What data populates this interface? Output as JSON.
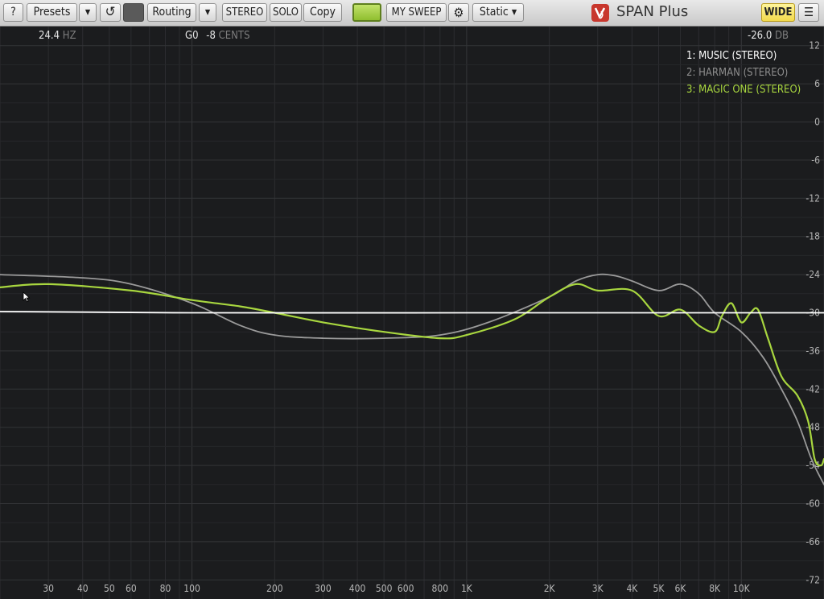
{
  "toolbar": {
    "help": "?",
    "presets": "Presets",
    "presets_arrow": "▾",
    "reset_icon": "↺",
    "routing": "Routing",
    "routing_arrow": "▾",
    "stereo": "STEREO",
    "solo": "SOLO",
    "copy": "Copy",
    "my_sweep": "MY SWEEP",
    "gear_icon": "⚙",
    "static": "Static ▾",
    "app_name": "SPAN Plus",
    "wide": "WIDE",
    "menu_icon": "☰"
  },
  "readouts": {
    "freq_value": "24.4",
    "freq_unit": "HZ",
    "note_name": "G0",
    "cents_value": "-8",
    "cents_unit": "CENTS",
    "db_value": "-26.0",
    "db_unit": "DB"
  },
  "colors": {
    "background": "#1b1c1e",
    "grid": "#2c2d30",
    "music": "#ffffff",
    "harman": "#9a9a9a",
    "magic_one": "#a8d63f",
    "led": "#9ccb35",
    "wide": "#f5e064"
  },
  "chart_data": {
    "type": "line",
    "xscale": "log",
    "xlim": [
      20,
      20000
    ],
    "ylim": [
      -75,
      15
    ],
    "x_ticks": [
      "30",
      "40",
      "50",
      "60",
      "80",
      "100",
      "200",
      "300",
      "400",
      "500",
      "600",
      "800",
      "1K",
      "2K",
      "3K",
      "4K",
      "5K",
      "6K",
      "8K",
      "10K"
    ],
    "y_ticks": [
      "12",
      "6",
      "0",
      "-6",
      "-12",
      "-18",
      "-24",
      "-30",
      "-36",
      "-42",
      "-48",
      "-54",
      "-60",
      "-66",
      "-72"
    ],
    "series": [
      {
        "name": "1: MUSIC (STEREO)",
        "color": "#ffffff",
        "x": [
          20,
          100,
          1000,
          10000,
          20000
        ],
        "y": [
          -29.8,
          -30,
          -30,
          -30,
          -30
        ]
      },
      {
        "name": "2: HARMAN (STEREO)",
        "color": "#9a9a9a",
        "x": [
          20,
          40,
          60,
          100,
          150,
          200,
          300,
          500,
          800,
          1200,
          2000,
          2500,
          3000,
          3500,
          4000,
          5000,
          6000,
          7000,
          8000,
          10000,
          12000,
          14000,
          16000,
          18000,
          20000
        ],
        "y": [
          -24,
          -24.5,
          -25.5,
          -28.5,
          -32,
          -33.5,
          -34,
          -34,
          -33.5,
          -31.5,
          -27.5,
          -25,
          -24,
          -24.2,
          -25,
          -26.5,
          -25.5,
          -27,
          -30,
          -33,
          -37,
          -42,
          -47,
          -53,
          -57
        ]
      },
      {
        "name": "3: MAGIC ONE (STEREO)",
        "color": "#a8d63f",
        "x": [
          20,
          30,
          60,
          100,
          150,
          200,
          300,
          500,
          800,
          1000,
          1500,
          2000,
          2500,
          3000,
          4000,
          5000,
          6000,
          7000,
          8000,
          8500,
          9200,
          10000,
          10800,
          11500,
          12500,
          14000,
          16000,
          17500,
          18500,
          19500,
          20000
        ],
        "y": [
          -26,
          -25.5,
          -26.5,
          -28,
          -29,
          -30,
          -31.5,
          -33,
          -34,
          -33.5,
          -31,
          -27.5,
          -25.5,
          -26.5,
          -26.5,
          -30.5,
          -29.5,
          -32,
          -33,
          -30.5,
          -28.5,
          -31.5,
          -30,
          -29.5,
          -34,
          -40,
          -43,
          -47,
          -53,
          -54,
          -53
        ]
      }
    ]
  },
  "legend": {
    "music": "1: MUSIC (STEREO)",
    "harman": "2: HARMAN (STEREO)",
    "magic": "3: MAGIC ONE (STEREO)"
  }
}
